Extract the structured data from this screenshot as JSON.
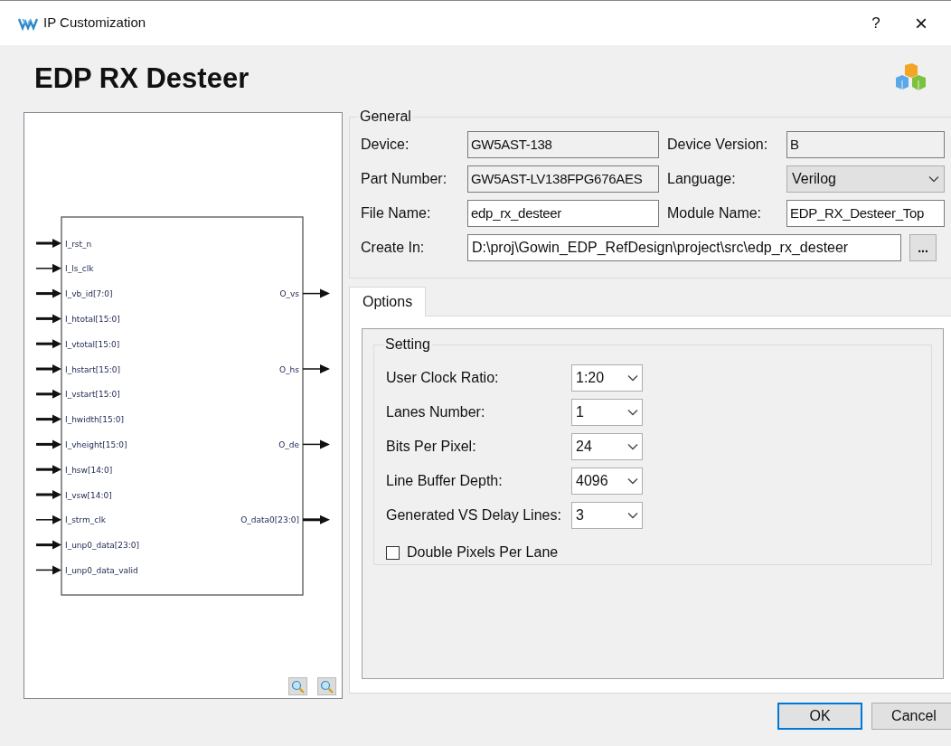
{
  "window": {
    "title": "IP Customization",
    "help": "?",
    "close": "×"
  },
  "heading": "EDP RX Desteer",
  "diagram": {
    "rows": [
      {
        "input": {
          "name": "I_rst_n",
          "wide": true
        }
      },
      {
        "input": {
          "name": "I_ls_clk",
          "wide": false
        }
      },
      {
        "input": {
          "name": "I_vb_id[7:0]",
          "wide": true
        },
        "output": {
          "name": "O_vs",
          "wide": false
        }
      },
      {
        "input": {
          "name": "I_htotal[15:0]",
          "wide": true
        }
      },
      {
        "input": {
          "name": "I_vtotal[15:0]",
          "wide": true
        }
      },
      {
        "input": {
          "name": "I_hstart[15:0]",
          "wide": true
        },
        "output": {
          "name": "O_hs",
          "wide": false
        }
      },
      {
        "input": {
          "name": "I_vstart[15:0]",
          "wide": true
        }
      },
      {
        "input": {
          "name": "I_hwidth[15:0]",
          "wide": true
        }
      },
      {
        "input": {
          "name": "I_vheight[15:0]",
          "wide": true
        },
        "output": {
          "name": "O_de",
          "wide": false
        }
      },
      {
        "input": {
          "name": "I_hsw[14:0]",
          "wide": true
        }
      },
      {
        "input": {
          "name": "I_vsw[14:0]",
          "wide": true
        }
      },
      {
        "input": {
          "name": "I_strm_clk",
          "wide": false
        },
        "output": {
          "name": "O_data0[23:0]",
          "wide": true
        }
      },
      {
        "input": {
          "name": "I_unp0_data[23:0]",
          "wide": true
        }
      },
      {
        "input": {
          "name": "I_unp0_data_valid",
          "wide": false
        }
      }
    ]
  },
  "general": {
    "title": "General",
    "fields": [
      {
        "label": "Device:",
        "value": "GW5AST-138",
        "kind": "readonly"
      },
      {
        "label": "Device Version:",
        "value": "B",
        "kind": "readonly"
      },
      {
        "label": "Part Number:",
        "value": "GW5AST-LV138FPG676AES",
        "kind": "readonly"
      },
      {
        "label": "Language:",
        "value": "Verilog",
        "kind": "combo"
      },
      {
        "label": "File Name:",
        "value": "edp_rx_desteer",
        "kind": "text"
      },
      {
        "label": "Module Name:",
        "value": "EDP_RX_Desteer_Top",
        "kind": "text"
      }
    ],
    "create_in": {
      "label": "Create In:",
      "value": "D:\\proj\\Gowin_EDP_RefDesign\\project\\src\\edp_rx_desteer",
      "browse": "..."
    }
  },
  "tabs": [
    {
      "label": "Options",
      "selected": true
    }
  ],
  "setting": {
    "title": "Setting",
    "options": [
      {
        "label": "User Clock Ratio:",
        "value": "1:20"
      },
      {
        "label": "Lanes Number:",
        "value": "1"
      },
      {
        "label": "Bits Per Pixel:",
        "value": "24"
      },
      {
        "label": "Line Buffer Depth:",
        "value": "4096"
      },
      {
        "label": "Generated VS Delay Lines:",
        "value": "3"
      }
    ],
    "checkbox": {
      "label": "Double Pixels Per Lane",
      "checked": false
    }
  },
  "buttons": [
    {
      "label": "OK",
      "default": true
    },
    {
      "label": "Cancel",
      "default": false
    }
  ]
}
